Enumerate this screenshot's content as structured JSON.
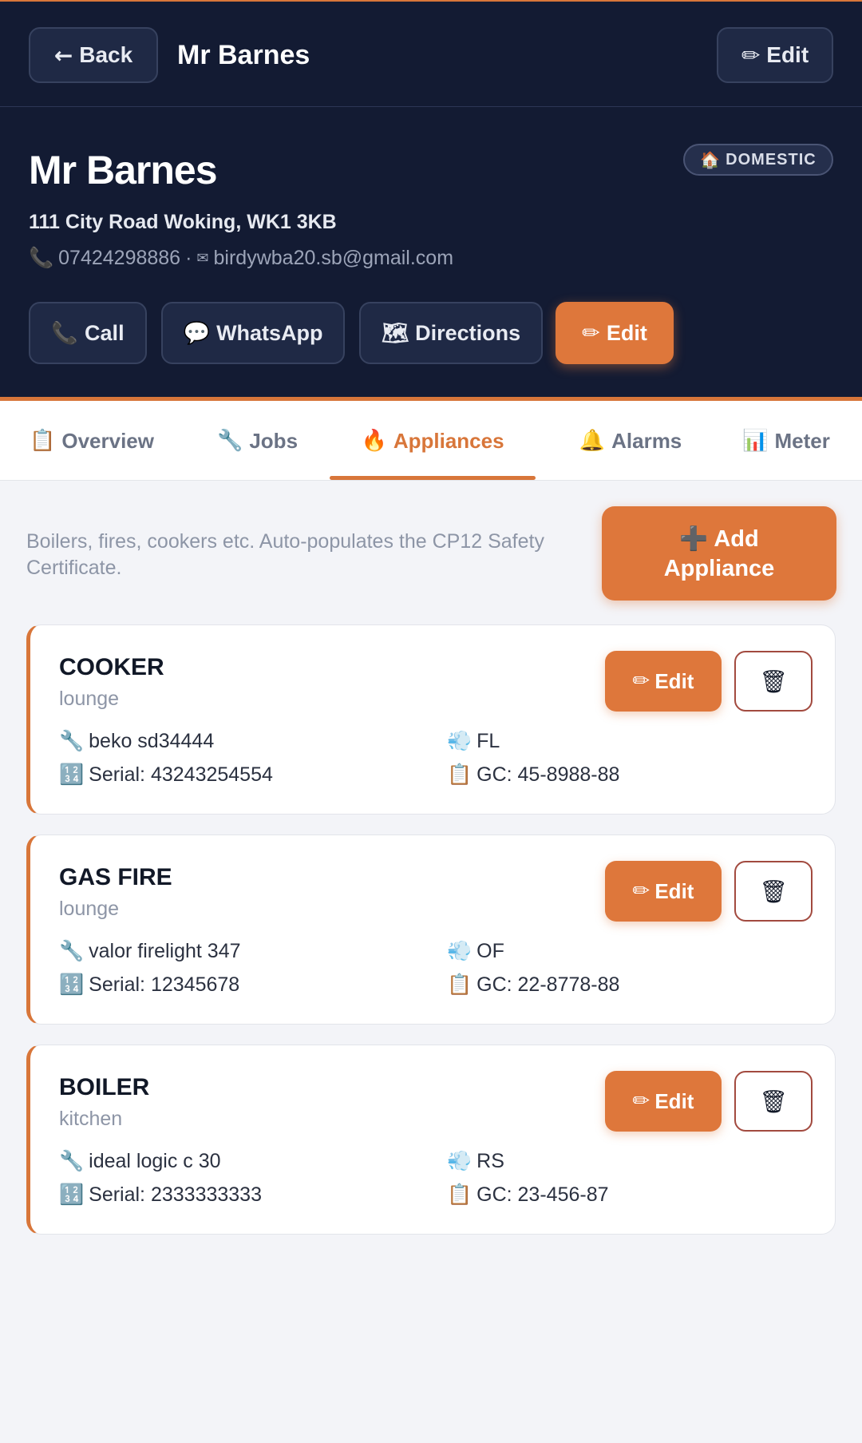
{
  "topbar": {
    "back_label": "Back",
    "title": "Mr Barnes",
    "edit_label": "Edit"
  },
  "customer": {
    "type_badge": "DOMESTIC",
    "name": "Mr Barnes",
    "address": "111 City Road Woking, WK1 3KB",
    "phone": "07424298886",
    "separator": "·",
    "email": "birdywba20.sb@gmail.com"
  },
  "actions": {
    "call": "Call",
    "whatsapp": "WhatsApp",
    "directions": "Directions",
    "edit": "Edit"
  },
  "tabs": [
    {
      "label": "Overview",
      "icon": "clipboard-icon",
      "active": false
    },
    {
      "label": "Jobs",
      "icon": "wrench-icon",
      "active": false
    },
    {
      "label": "Appliances",
      "icon": "fire-icon",
      "active": true
    },
    {
      "label": "Alarms",
      "icon": "bell-icon",
      "active": false
    },
    {
      "label": "Meter",
      "icon": "bar-chart-icon",
      "active": false
    }
  ],
  "appliances_panel": {
    "intro": "Boilers, fires, cookers etc. Auto-populates the CP12 Safety Certificate.",
    "add_label_line1": "Add",
    "add_label_line2": "Appliance",
    "edit_label": "Edit"
  },
  "appliances": [
    {
      "type": "COOKER",
      "location": "lounge",
      "make_model": "beko sd34444",
      "flue": "FL",
      "serial": "Serial: 43243254554",
      "gc": "GC: 45-8988-88"
    },
    {
      "type": "GAS FIRE",
      "location": "lounge",
      "make_model": "valor firelight 347",
      "flue": "OF",
      "serial": "Serial: 12345678",
      "gc": "GC: 22-8778-88"
    },
    {
      "type": "BOILER",
      "location": "kitchen",
      "make_model": "ideal logic c 30",
      "flue": "RS",
      "serial": "Serial: 2333333333",
      "gc": "GC: 23-456-87"
    }
  ],
  "colors": {
    "navy": "#131b33",
    "accent": "#de773b",
    "background": "#f3f4f8"
  }
}
